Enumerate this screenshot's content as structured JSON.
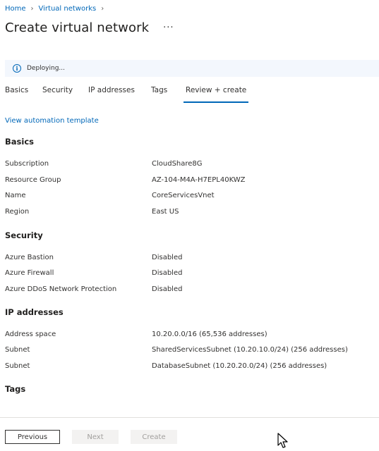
{
  "breadcrumb": {
    "home": "Home",
    "vnets": "Virtual networks"
  },
  "header": {
    "title": "Create virtual network",
    "more": "···"
  },
  "banner": {
    "text": "Deploying..."
  },
  "tabs": [
    "Basics",
    "Security",
    "IP addresses",
    "Tags",
    "Review + create"
  ],
  "automation_link": "View automation template",
  "sections": {
    "basics": {
      "heading": "Basics",
      "rows": [
        {
          "label": "Subscription",
          "value": "CloudShare8G"
        },
        {
          "label": "Resource Group",
          "value": "AZ-104-M4A-H7EPL40KWZ"
        },
        {
          "label": "Name",
          "value": "CoreServicesVnet"
        },
        {
          "label": "Region",
          "value": "East US"
        }
      ]
    },
    "security": {
      "heading": "Security",
      "rows": [
        {
          "label": "Azure Bastion",
          "value": "Disabled"
        },
        {
          "label": "Azure Firewall",
          "value": "Disabled"
        },
        {
          "label": "Azure DDoS Network Protection",
          "value": "Disabled"
        }
      ]
    },
    "ip": {
      "heading": "IP addresses",
      "rows": [
        {
          "label": "Address space",
          "value": "10.20.0.0/16 (65,536 addresses)"
        },
        {
          "label": "Subnet",
          "value": "SharedServicesSubnet (10.20.10.0/24) (256 addresses)"
        },
        {
          "label": "Subnet",
          "value": "DatabaseSubnet (10.20.20.0/24) (256 addresses)"
        }
      ]
    },
    "tags": {
      "heading": "Tags"
    }
  },
  "footer": {
    "previous": "Previous",
    "next": "Next",
    "create": "Create"
  },
  "colors": {
    "accent": "#0067b8",
    "banner_bg": "#f3f7fd",
    "disabled_bg": "#f3f2f1"
  }
}
